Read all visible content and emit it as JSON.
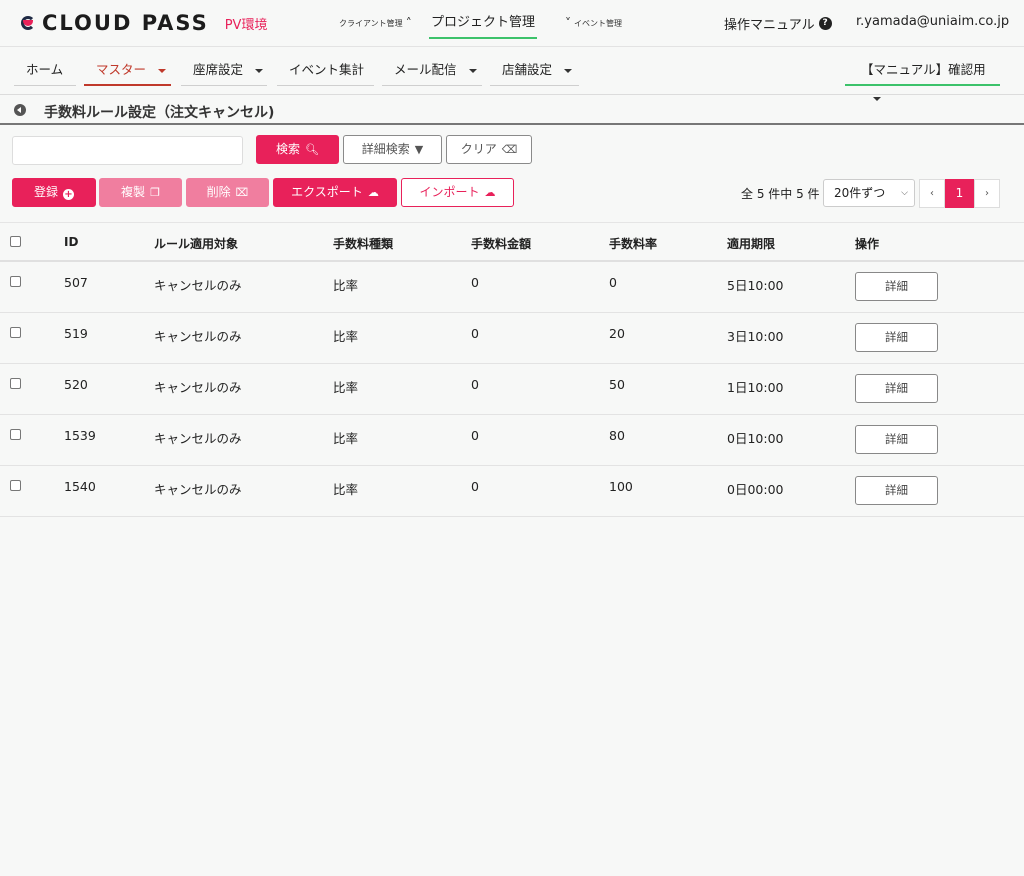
{
  "header": {
    "logo_text": "CLOUD PASS",
    "env_label": "PV環境",
    "nav_client": "クライアント管理",
    "nav_project": "プロジェクト管理",
    "nav_event": "イベント管理",
    "manual": "操作マニュアル",
    "user": "r.yamada@uniaim.co.jp"
  },
  "menu": {
    "items": [
      {
        "label": "ホーム"
      },
      {
        "label": "マスター"
      },
      {
        "label": "座席設定"
      },
      {
        "label": "イベント集計"
      },
      {
        "label": "メール配信"
      },
      {
        "label": "店舗設定"
      }
    ],
    "right_label": "【マニュアル】確認用"
  },
  "page": {
    "title": "手数料ルール設定（注文キャンセル)"
  },
  "search": {
    "value": "",
    "search_label": "検索",
    "advanced_label": "詳細検索",
    "clear_label": "クリア"
  },
  "actions": {
    "register": "登録",
    "copy": "複製",
    "delete": "削除",
    "export": "エクスポート",
    "import": "インポート"
  },
  "pagination": {
    "count_text": "全 5 件中 5 件",
    "per_page": "20件ずつ",
    "prev": "‹",
    "current": "1",
    "next": "›"
  },
  "table": {
    "headers": {
      "id": "ID",
      "target": "ルール適用対象",
      "type": "手数料種類",
      "amount": "手数料金額",
      "rate": "手数料率",
      "period": "適用期限",
      "action": "操作"
    },
    "detail_label": "詳細",
    "rows": [
      {
        "id": "507",
        "target": "キャンセルのみ",
        "type": "比率",
        "amount": "0",
        "rate": "0",
        "period": "5日10:00"
      },
      {
        "id": "519",
        "target": "キャンセルのみ",
        "type": "比率",
        "amount": "0",
        "rate": "20",
        "period": "3日10:00"
      },
      {
        "id": "520",
        "target": "キャンセルのみ",
        "type": "比率",
        "amount": "0",
        "rate": "50",
        "period": "1日10:00"
      },
      {
        "id": "1539",
        "target": "キャンセルのみ",
        "type": "比率",
        "amount": "0",
        "rate": "80",
        "period": "0日10:00"
      },
      {
        "id": "1540",
        "target": "キャンセルのみ",
        "type": "比率",
        "amount": "0",
        "rate": "100",
        "period": "0日00:00"
      }
    ]
  }
}
